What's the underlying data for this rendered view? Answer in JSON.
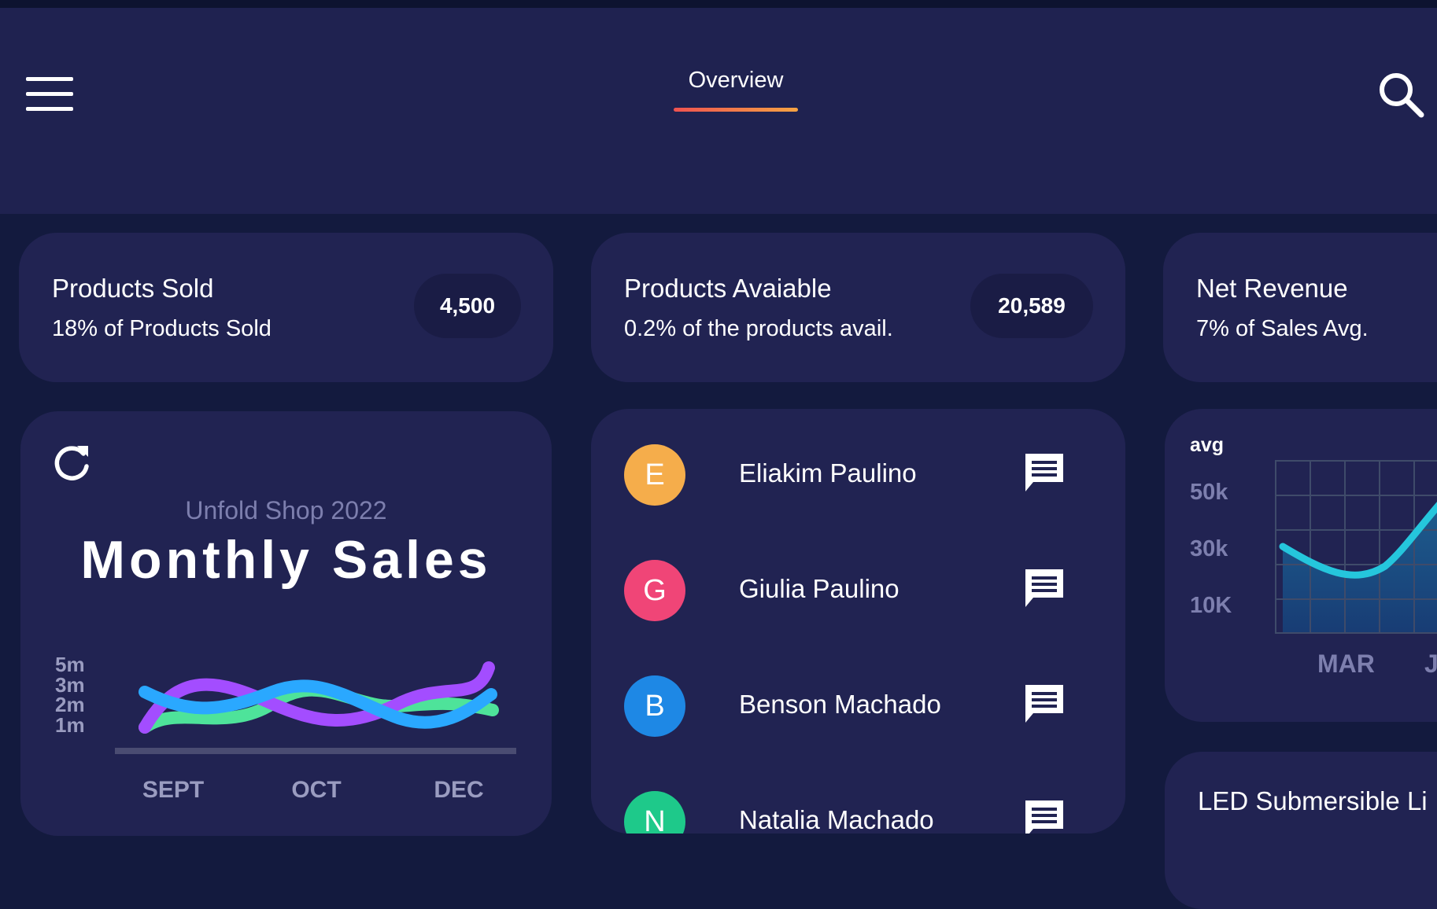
{
  "header": {
    "menu_icon": "menu-icon",
    "active_tab": "Overview",
    "search_icon": "search-icon",
    "accent_gradient": [
      "#ef5350",
      "#f5a343"
    ]
  },
  "stats": [
    {
      "title": "Products Sold",
      "subtitle": "18% of Products Sold",
      "value": "4,500"
    },
    {
      "title": "Products Avaiable",
      "subtitle": "0.2% of the products avail.",
      "value": "20,589"
    },
    {
      "title": "Net Revenue",
      "subtitle": "7% of Sales Avg."
    }
  ],
  "monthly_sales": {
    "refresh_icon": "refresh-icon",
    "subtitle": "Unfold Shop 2022",
    "title": "Monthly Sales",
    "y_labels": [
      "5m",
      "3m",
      "2m",
      "1m"
    ],
    "x_labels": [
      "SEPT",
      "OCT",
      "DEC"
    ],
    "series_colors": [
      "#4ee39a",
      "#a34dff",
      "#2aa8ff"
    ]
  },
  "contacts": [
    {
      "initial": "E",
      "name": "Eliakim Paulino",
      "color": "#f5ad4b"
    },
    {
      "initial": "G",
      "name": "Giulia Paulino",
      "color": "#f04577"
    },
    {
      "initial": "B",
      "name": "Benson Machado",
      "color": "#1e88e5"
    },
    {
      "initial": "N",
      "name": "Natalia Machado",
      "color": "#1ec98a"
    }
  ],
  "avg_chart": {
    "label": "avg",
    "y_labels": [
      "50k",
      "30k",
      "10K"
    ],
    "x_labels": [
      "MAR",
      "J"
    ],
    "line_color": "#25c6dc"
  },
  "product_card": {
    "title": "LED Submersible Li"
  }
}
